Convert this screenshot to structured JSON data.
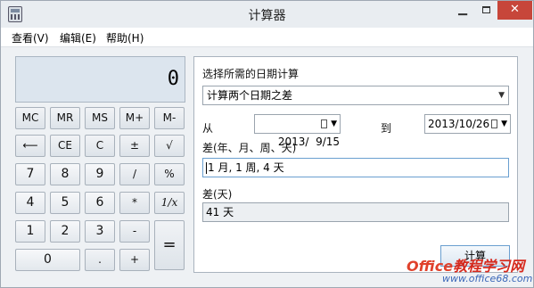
{
  "window": {
    "title": "计算器"
  },
  "menu": {
    "view": "查看(V)",
    "edit": "编辑(E)",
    "help": "帮助(H)"
  },
  "display": {
    "value": "0"
  },
  "keys": {
    "mc": "MC",
    "mr": "MR",
    "ms": "MS",
    "mplus": "M+",
    "mminus": "M-",
    "back": "⟵",
    "ce": "CE",
    "c": "C",
    "plusminus": "±",
    "sqrt": "√",
    "d7": "7",
    "d8": "8",
    "d9": "9",
    "divide": "/",
    "percent": "%",
    "d4": "4",
    "d5": "5",
    "d6": "6",
    "multiply": "*",
    "reciprocal": "1/x",
    "d1": "1",
    "d2": "2",
    "d3": "3",
    "minus": "-",
    "equals": "=",
    "d0": "0",
    "dot": ".",
    "plus": "+"
  },
  "date_calc": {
    "heading": "选择所需的日期计算",
    "mode": "计算两个日期之差",
    "from_label": "从",
    "from_date": "2013/  9/15",
    "to_label": "到",
    "to_date": "2013/10/26",
    "diff_label": "差(年、月、周、天)",
    "diff_value": "1 月, 1 周, 4 天",
    "days_label": "差(天)",
    "days_value": "41 天",
    "calc_button": "计算"
  },
  "watermark": {
    "line1_brand": "Office",
    "line1_rest": "教程学习网",
    "line2": "www.office68.com"
  }
}
